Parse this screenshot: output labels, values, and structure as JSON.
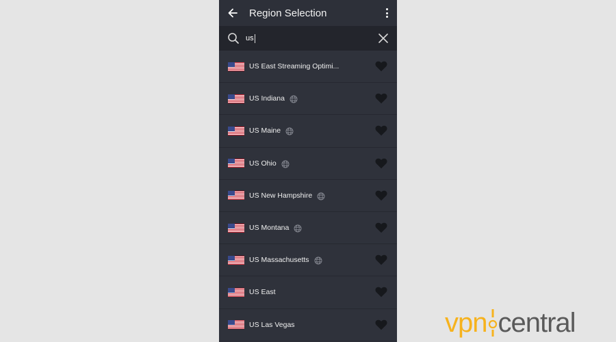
{
  "app_bar": {
    "title": "Region Selection",
    "back_icon": "arrow-left-icon",
    "menu_icon": "more-vertical-icon"
  },
  "search": {
    "value": "us",
    "search_icon": "search-icon",
    "clear_icon": "close-icon"
  },
  "regions": [
    {
      "label": "US East Streaming Optimi...",
      "streaming": false
    },
    {
      "label": "US Indiana",
      "streaming": true
    },
    {
      "label": "US Maine",
      "streaming": true
    },
    {
      "label": "US Ohio",
      "streaming": true
    },
    {
      "label": "US New Hampshire",
      "streaming": true
    },
    {
      "label": "US Montana",
      "streaming": true
    },
    {
      "label": "US Massachusetts",
      "streaming": true
    },
    {
      "label": "US East",
      "streaming": false
    },
    {
      "label": "US Las Vegas",
      "streaming": false
    }
  ],
  "watermark": {
    "part1": "vpn",
    "part2": "central"
  },
  "colors": {
    "background": "#e5e5e5",
    "panel": "#2f323b",
    "search_bg": "#23252c",
    "heart": "#16181c",
    "watermark_accent": "#f6b21d"
  }
}
